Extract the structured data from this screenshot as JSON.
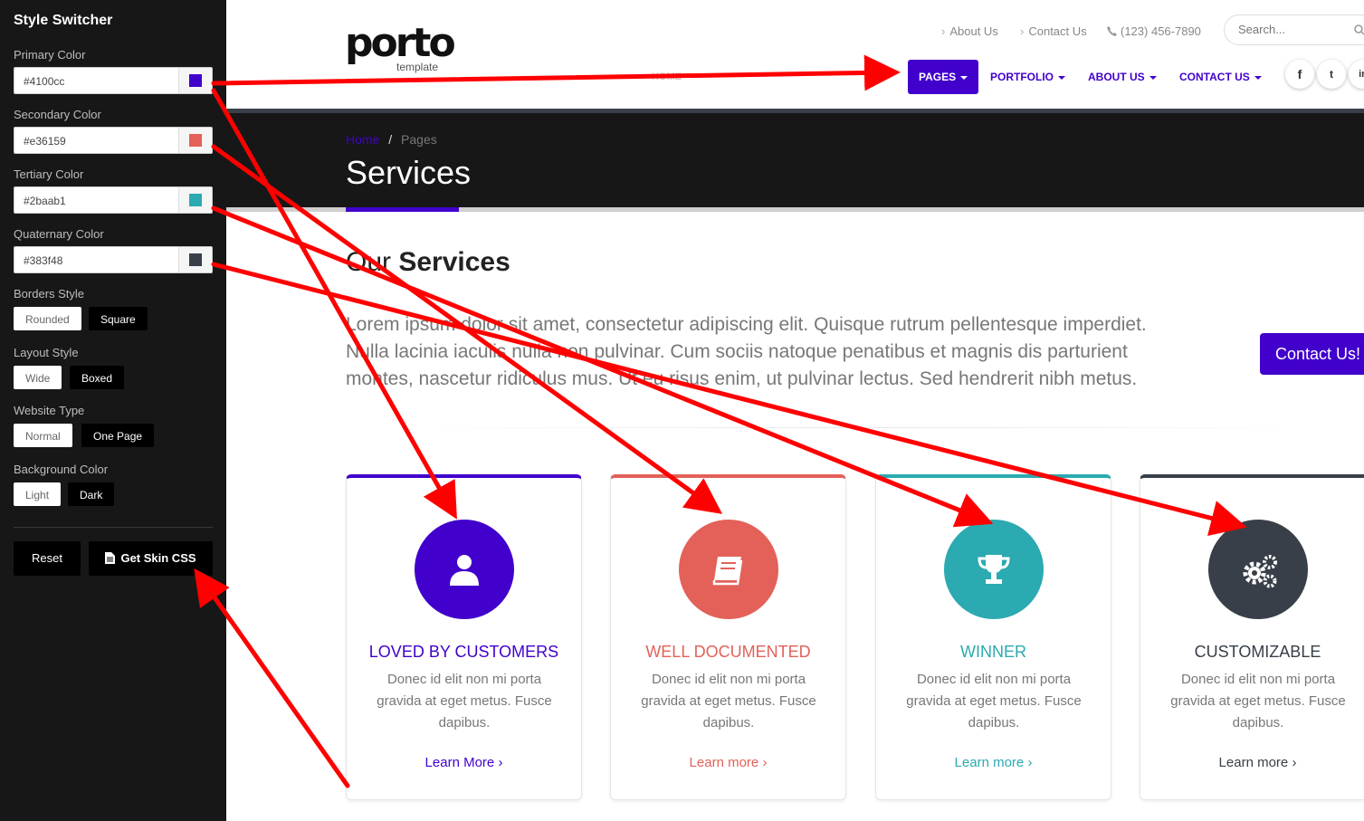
{
  "switcher": {
    "title": "Style Switcher",
    "colors": [
      {
        "label": "Primary Color",
        "value": "#4100cc",
        "swatch": "#4100cc"
      },
      {
        "label": "Secondary Color",
        "value": "#e36159",
        "swatch": "#e36159"
      },
      {
        "label": "Tertiary Color",
        "value": "#2baab1",
        "swatch": "#2baab1"
      },
      {
        "label": "Quaternary Color",
        "value": "#383f48",
        "swatch": "#383f48"
      }
    ],
    "borders": {
      "label": "Borders Style",
      "options": [
        "Rounded",
        "Square"
      ],
      "selected": "Rounded"
    },
    "layout": {
      "label": "Layout Style",
      "options": [
        "Wide",
        "Boxed"
      ],
      "selected": "Wide"
    },
    "website_type": {
      "label": "Website Type",
      "options": [
        "Normal",
        "One Page"
      ],
      "selected": "Normal"
    },
    "background": {
      "label": "Background Color",
      "options": [
        "Light",
        "Dark"
      ],
      "selected": "Light"
    },
    "reset_label": "Reset",
    "get_css_label": "Get Skin CSS"
  },
  "header": {
    "logo_text": "porto",
    "logo_sub": "template",
    "top_links": [
      "About Us",
      "Contact Us"
    ],
    "phone": "(123) 456-7890",
    "search_placeholder": "Search...",
    "nav": [
      {
        "label": "HOME",
        "active": false
      },
      {
        "label": "PAGES",
        "active": true
      },
      {
        "label": "PORTFOLIO",
        "active": false
      },
      {
        "label": "ABOUT US",
        "active": false
      },
      {
        "label": "CONTACT US",
        "active": false
      }
    ],
    "social": [
      "facebook-icon",
      "twitter-icon",
      "linkedin-icon"
    ],
    "social_glyphs": [
      "f",
      "t",
      "in"
    ]
  },
  "page_header": {
    "breadcrumb_home": "Home",
    "breadcrumb_sep": "/",
    "breadcrumb_current": "Pages",
    "title": "Services"
  },
  "intro": {
    "heading_light": "Our",
    "heading_bold": "Services",
    "lead": "Lorem ipsum dolor sit amet, consectetur adipiscing elit. Quisque rutrum pellentesque imperdiet. Nulla lacinia iaculis nulla non pulvinar. Cum sociis natoque penatibus et magnis dis parturient montes, nascetur ridiculus mus. Ut eu risus enim, ut pulvinar lectus. Sed hendrerit nibh metus.",
    "contact_button": "Contact Us!"
  },
  "features": [
    {
      "title": "LOVED BY CUSTOMERS",
      "text": "Donec id elit non mi porta gravida at eget metus. Fusce dapibus.",
      "link": "Learn More",
      "color": "#4100cc",
      "icon": "user-icon"
    },
    {
      "title": "WELL DOCUMENTED",
      "text": "Donec id elit non mi porta gravida at eget metus. Fusce dapibus.",
      "link": "Learn more",
      "color": "#e36159",
      "icon": "book-icon"
    },
    {
      "title": "WINNER",
      "text": "Donec id elit non mi porta gravida at eget metus. Fusce dapibus.",
      "link": "Learn more",
      "color": "#2baab1",
      "icon": "trophy-icon"
    },
    {
      "title": "CUSTOMIZABLE",
      "text": "Donec id elit non mi porta gravida at eget metus. Fusce dapibus.",
      "link": "Learn more",
      "color": "#383f48",
      "icon": "gears-icon"
    }
  ],
  "annotation_color": "#ff0000"
}
